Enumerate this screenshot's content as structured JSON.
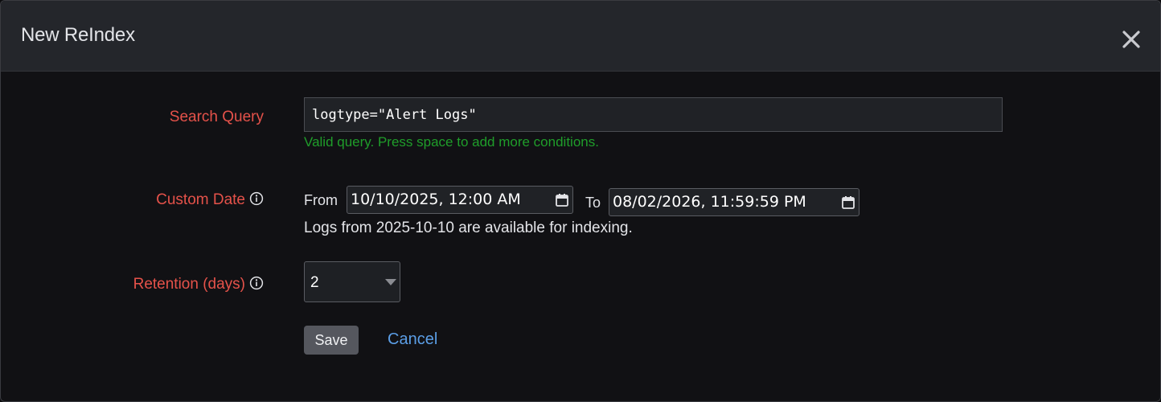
{
  "dialog": {
    "title": "New ReIndex"
  },
  "form": {
    "search_query": {
      "label": "Search Query",
      "value": "logtype=\"Alert Logs\"",
      "message": "Valid query. Press space to add more conditions."
    },
    "custom_date": {
      "label": "Custom Date",
      "from_label": "From",
      "from_value": "10/10/2025, 12:00 AM",
      "to_label": "To",
      "to_value": "08/02/2026, 11:59:59 PM",
      "message": "Logs from 2025-10-10 are available for indexing."
    },
    "retention": {
      "label": "Retention (days)",
      "selected": "2"
    }
  },
  "actions": {
    "save_label": "Save",
    "cancel_label": "Cancel"
  },
  "colors": {
    "label": "#e5524a",
    "valid": "#1f9d2a",
    "link": "#5b9ee6"
  },
  "icons": {
    "close": "close-icon",
    "info": "info-icon",
    "calendar": "calendar-icon",
    "dropdown": "caret-down-icon"
  }
}
